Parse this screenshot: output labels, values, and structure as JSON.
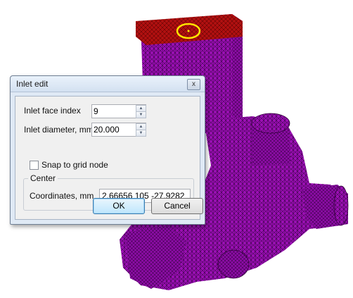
{
  "dialog": {
    "title": "Inlet edit",
    "close_glyph": "x",
    "face_index_label": "Inlet face index",
    "face_index_value": "9",
    "diameter_label": "Inlet diameter, mm",
    "diameter_value": "20.000",
    "snap_label": "Snap to grid node",
    "snap_checked": false,
    "center_group_label": "Center",
    "coordinates_label": "Coordinates, mm",
    "coordinates_value": "2.66656 105 -27.9282",
    "ok_label": "OK",
    "cancel_label": "Cancel"
  },
  "colors": {
    "mesh_fill": "#9b10b4",
    "mesh_lines": "#2a0033",
    "inlet_face": "#b01010",
    "inlet_marker": "#ffe600"
  }
}
